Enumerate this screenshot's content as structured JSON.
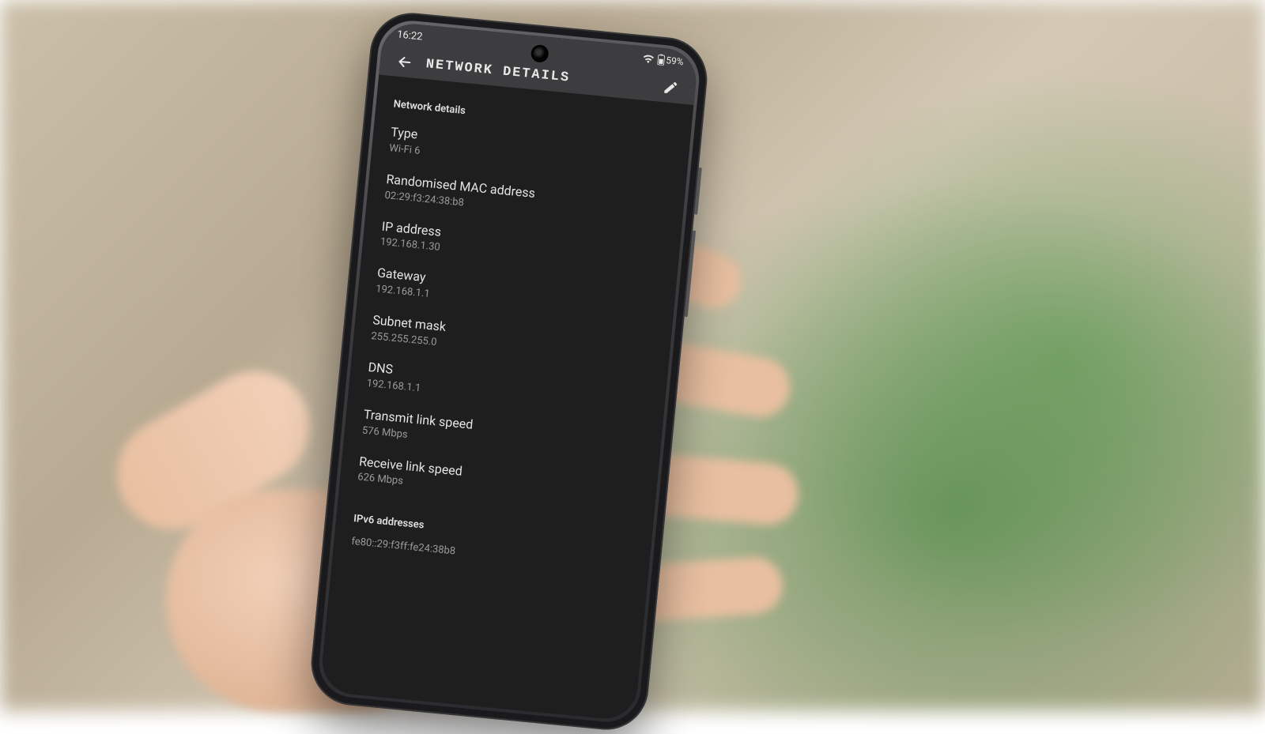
{
  "status_bar": {
    "time": "16:22",
    "battery_pct": "59%"
  },
  "header": {
    "title": "NETWORK DETAILS"
  },
  "section1_label": "Network details",
  "details": [
    {
      "title": "Type",
      "value": "Wi-Fi 6"
    },
    {
      "title": "Randomised MAC address",
      "value": "02:29:f3:24:38:b8"
    },
    {
      "title": "IP address",
      "value": "192.168.1.30"
    },
    {
      "title": "Gateway",
      "value": "192.168.1.1"
    },
    {
      "title": "Subnet mask",
      "value": "255.255.255.0"
    },
    {
      "title": "DNS",
      "value": "192.168.1.1"
    },
    {
      "title": "Transmit link speed",
      "value": "576 Mbps"
    },
    {
      "title": "Receive link speed",
      "value": "626 Mbps"
    }
  ],
  "section2_label": "IPv6 addresses",
  "ipv6": [
    "fe80::29:f3ff:fe24:38b8"
  ]
}
